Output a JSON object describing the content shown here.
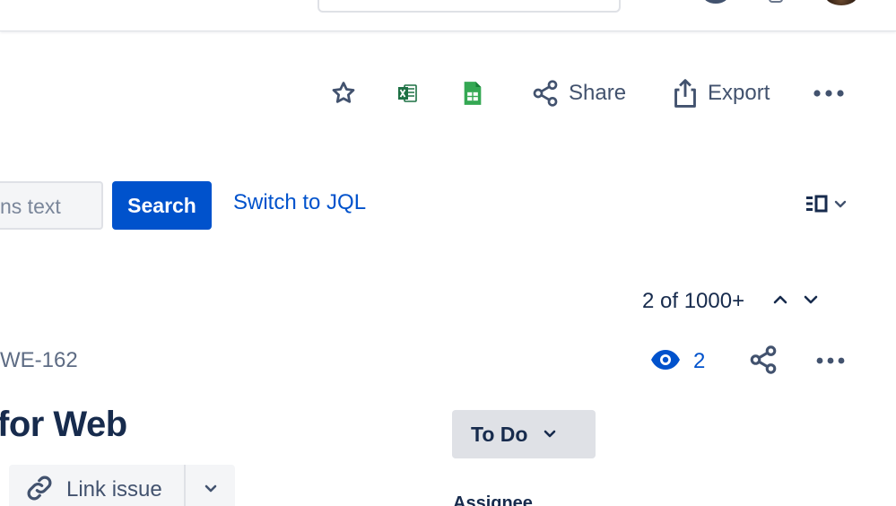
{
  "toolbar": {
    "star_icon": "star-icon",
    "excel_icon": "excel-icon",
    "sheets_icon": "google-sheets-icon",
    "share_label": "Share",
    "export_label": "Export",
    "more_icon": "more-icon"
  },
  "search": {
    "text_placeholder": "ns text",
    "button_label": "Search",
    "switch_label": "Switch to JQL"
  },
  "pager": {
    "count": "2 of 1000+"
  },
  "issue": {
    "key": "WE-162",
    "watchers": "2",
    "summary": "for Web",
    "status": "To Do",
    "link_label": "Link issue",
    "assignee_label": "Assignee"
  },
  "colors": {
    "primary": "#0052cc",
    "text": "#172b4d",
    "subtle": "#42526e",
    "excel_green": "#1d7044",
    "sheets_green": "#34a853"
  }
}
